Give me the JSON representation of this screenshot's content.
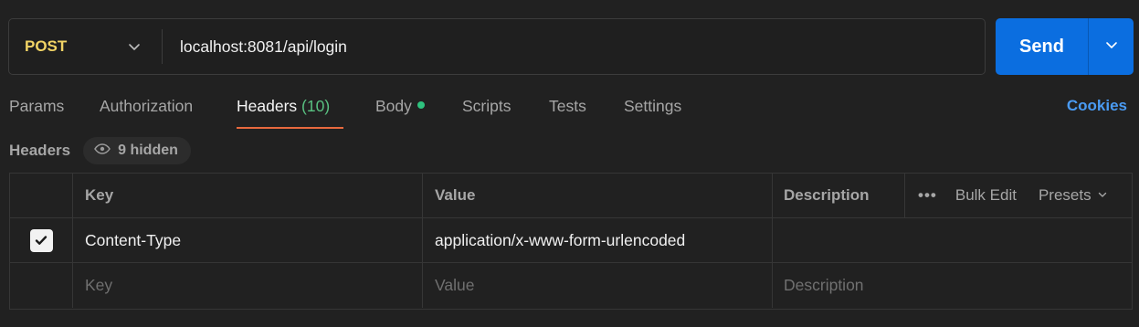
{
  "request": {
    "method": "POST",
    "url": "localhost:8081/api/login",
    "send_label": "Send"
  },
  "tabs": {
    "params": "Params",
    "authorization": "Authorization",
    "headers": "Headers",
    "headers_count": "(10)",
    "body": "Body",
    "scripts": "Scripts",
    "tests": "Tests",
    "settings": "Settings",
    "cookies": "Cookies"
  },
  "headers_section": {
    "title": "Headers",
    "hidden_label": "9 hidden"
  },
  "table": {
    "columns": {
      "key": "Key",
      "value": "Value",
      "description": "Description"
    },
    "actions": {
      "bulk_edit": "Bulk Edit",
      "presets": "Presets"
    },
    "rows": [
      {
        "enabled": true,
        "key": "Content-Type",
        "value": "application/x-www-form-urlencoded",
        "description": ""
      }
    ],
    "placeholders": {
      "key": "Key",
      "value": "Value",
      "description": "Description"
    }
  },
  "colors": {
    "method": "#f2d465",
    "send": "#0b6ee0",
    "active_underline": "#e8693e",
    "count": "#59c181",
    "link": "#4a9bf3"
  }
}
